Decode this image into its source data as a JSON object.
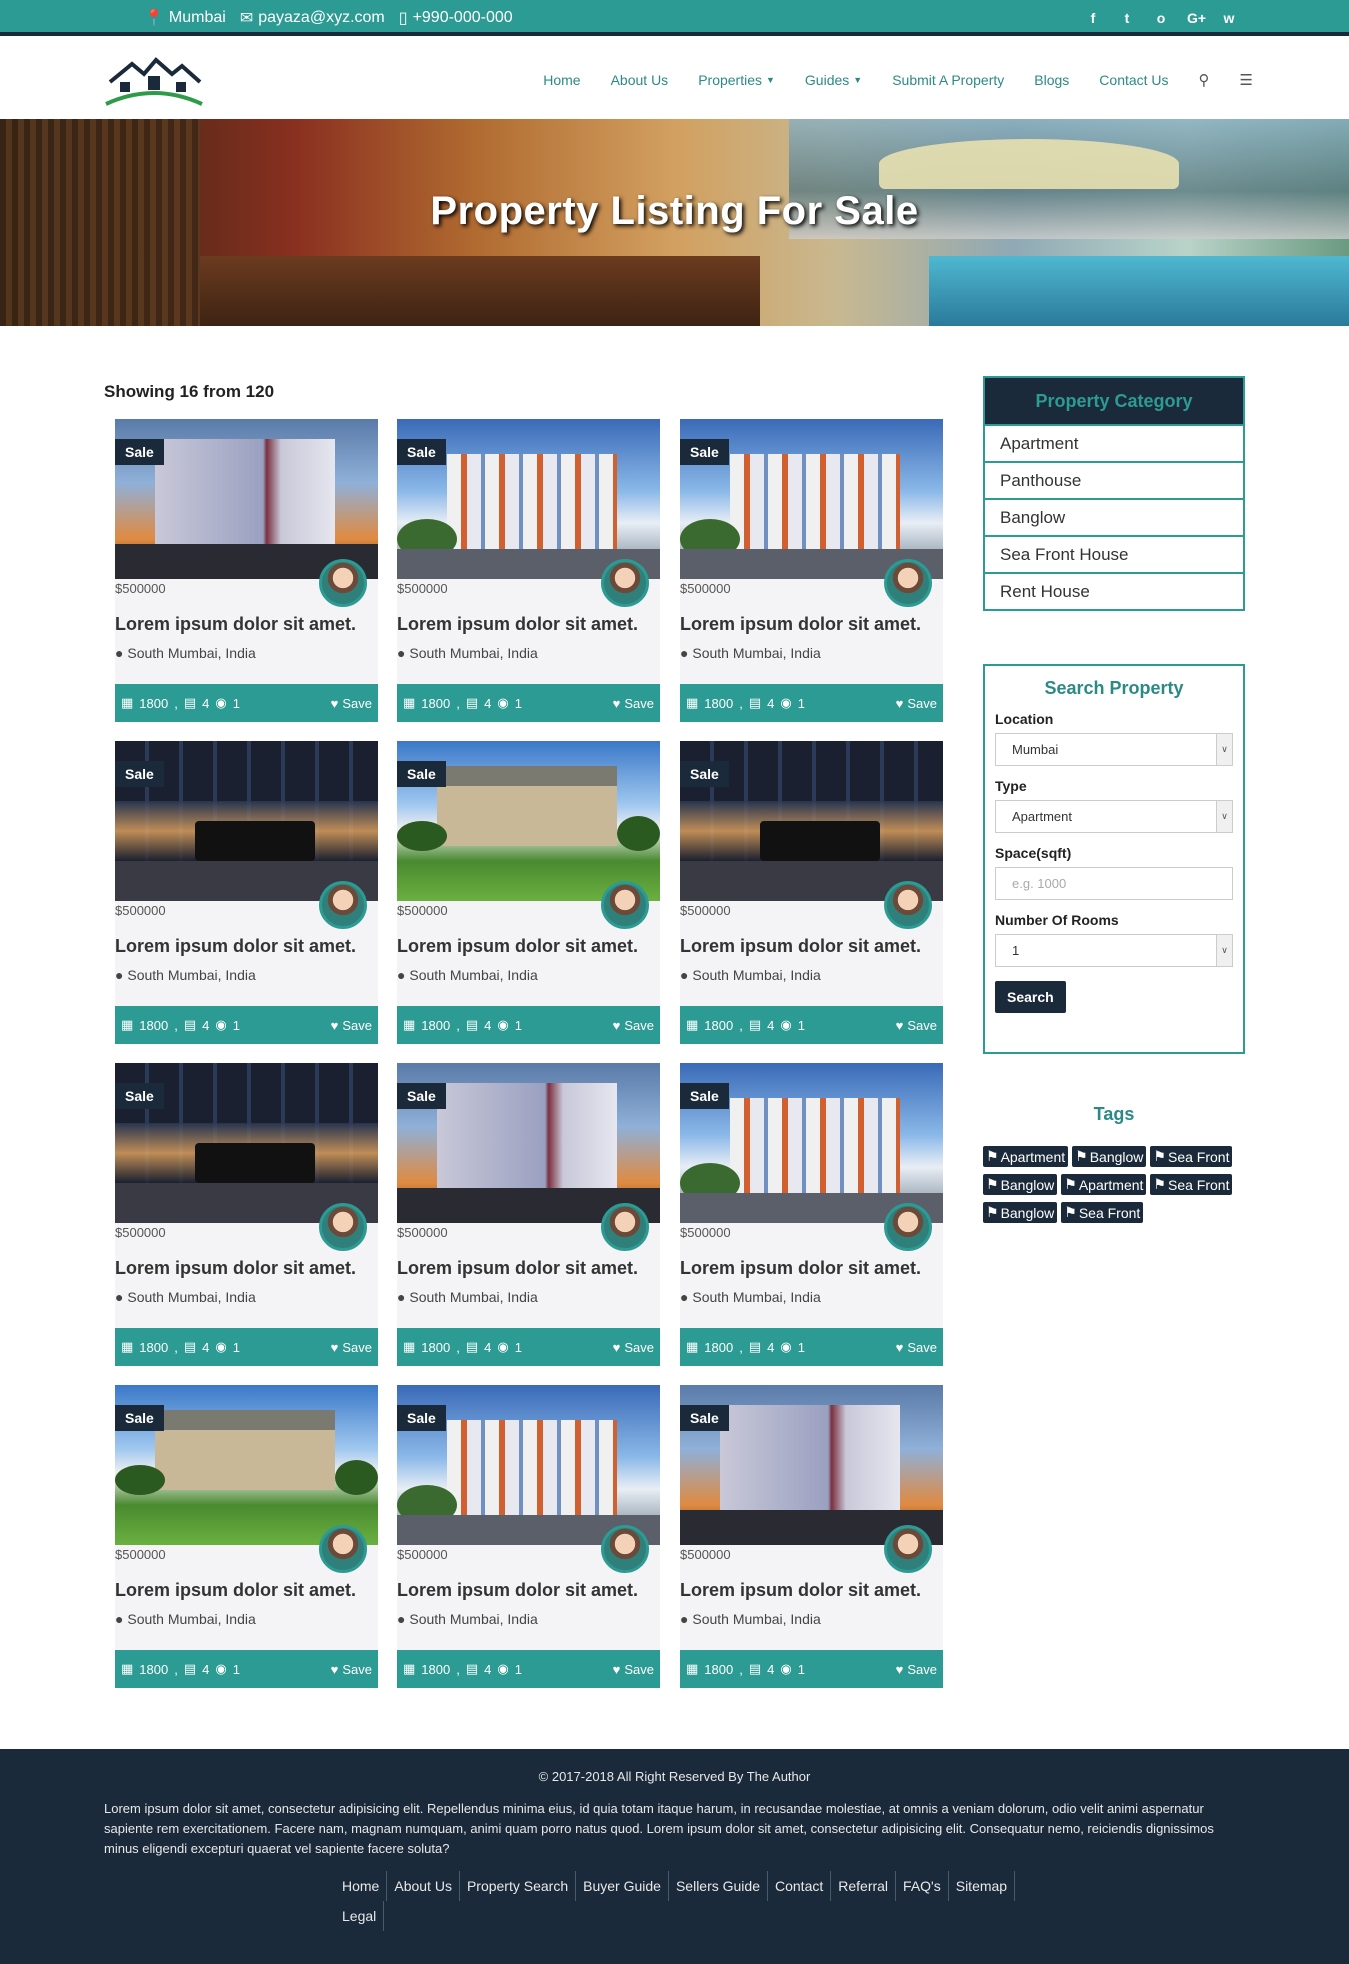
{
  "topbar": {
    "city": "Mumbai",
    "email": "payaza@xyz.com",
    "phone": "+990-000-000",
    "social": [
      "f",
      "t",
      "o",
      "G+",
      "w"
    ]
  },
  "nav": {
    "items": [
      "Home",
      "About Us",
      "Properties",
      "Guides",
      "Submit A Property",
      "Blogs",
      "Contact Us"
    ]
  },
  "hero": {
    "title": "Property Listing For Sale"
  },
  "listing": {
    "showing": "Showing 16 from 120",
    "cards": [
      {
        "badge": "Sale",
        "price": "$500000",
        "title": "Lorem ipsum dolor sit amet.",
        "location": "South Mumbai, India",
        "area": "1800",
        "beds": "4",
        "cars": "1",
        "save": "Save",
        "img": "modern"
      },
      {
        "badge": "Sale",
        "price": "$500000",
        "title": "Lorem ipsum dolor sit amet.",
        "location": "South Mumbai, India",
        "area": "1800",
        "beds": "4",
        "cars": "1",
        "save": "Save",
        "img": "apartment"
      },
      {
        "badge": "Sale",
        "price": "$500000",
        "title": "Lorem ipsum dolor sit amet.",
        "location": "South Mumbai, India",
        "area": "1800",
        "beds": "4",
        "cars": "1",
        "save": "Save",
        "img": "apartment"
      },
      {
        "badge": "Sale",
        "price": "$500000",
        "title": "Lorem ipsum dolor sit amet.",
        "location": "South Mumbai, India",
        "area": "1800",
        "beds": "4",
        "cars": "1",
        "save": "Save",
        "img": "interior"
      },
      {
        "badge": "Sale",
        "price": "$500000",
        "title": "Lorem ipsum dolor sit amet.",
        "location": "South Mumbai, India",
        "area": "1800",
        "beds": "4",
        "cars": "1",
        "save": "Save",
        "img": "house"
      },
      {
        "badge": "Sale",
        "price": "$500000",
        "title": "Lorem ipsum dolor sit amet.",
        "location": "South Mumbai, India",
        "area": "1800",
        "beds": "4",
        "cars": "1",
        "save": "Save",
        "img": "interior"
      },
      {
        "badge": "Sale",
        "price": "$500000",
        "title": "Lorem ipsum dolor sit amet.",
        "location": "South Mumbai, India",
        "area": "1800",
        "beds": "4",
        "cars": "1",
        "save": "Save",
        "img": "interior"
      },
      {
        "badge": "Sale",
        "price": "$500000",
        "title": "Lorem ipsum dolor sit amet.",
        "location": "South Mumbai, India",
        "area": "1800",
        "beds": "4",
        "cars": "1",
        "save": "Save",
        "img": "modern"
      },
      {
        "badge": "Sale",
        "price": "$500000",
        "title": "Lorem ipsum dolor sit amet.",
        "location": "South Mumbai, India",
        "area": "1800",
        "beds": "4",
        "cars": "1",
        "save": "Save",
        "img": "apartment"
      },
      {
        "badge": "Sale",
        "price": "$500000",
        "title": "Lorem ipsum dolor sit amet.",
        "location": "South Mumbai, India",
        "area": "1800",
        "beds": "4",
        "cars": "1",
        "save": "Save",
        "img": "house"
      },
      {
        "badge": "Sale",
        "price": "$500000",
        "title": "Lorem ipsum dolor sit amet.",
        "location": "South Mumbai, India",
        "area": "1800",
        "beds": "4",
        "cars": "1",
        "save": "Save",
        "img": "apartment"
      },
      {
        "badge": "Sale",
        "price": "$500000",
        "title": "Lorem ipsum dolor sit amet.",
        "location": "South Mumbai, India",
        "area": "1800",
        "beds": "4",
        "cars": "1",
        "save": "Save",
        "img": "modern"
      }
    ]
  },
  "sidebar": {
    "category_title": "Property Category",
    "categories": [
      "Apartment",
      "Panthouse",
      "Banglow",
      "Sea Front House",
      "Rent House"
    ],
    "search": {
      "title": "Search Property",
      "location_label": "Location",
      "location_value": "Mumbai",
      "type_label": "Type",
      "type_value": "Apartment",
      "space_label": "Space(sqft)",
      "space_placeholder": "e.g. 1000",
      "rooms_label": "Number Of Rooms",
      "rooms_value": "1",
      "button": "Search"
    },
    "tags_title": "Tags",
    "tags": [
      "Apartment",
      "Banglow",
      "Sea Front",
      "Banglow",
      "Apartment",
      "Sea Front",
      "Banglow",
      "Sea Front"
    ]
  },
  "footer": {
    "copyright": "© 2017-2018 All Right Reserved By The Author",
    "text": "Lorem ipsum dolor sit amet, consectetur adipisicing elit. Repellendus minima eius, id quia totam itaque harum, in recusandae molestiae, at omnis a veniam dolorum, odio velit animi aspernatur sapiente rem exercitationem. Facere nam, magnam numquam, animi quam porro natus quod. Lorem ipsum dolor sit amet, consectetur adipisicing elit. Consequatur nemo, reiciendis dignissimos minus eligendi excepturi quaerat vel sapiente facere soluta?",
    "links": [
      "Home",
      "About Us",
      "Property Search",
      "Buyer Guide",
      "Sellers Guide",
      "Contact",
      "Referral",
      "FAQ's",
      "Sitemap",
      "Legal"
    ]
  },
  "colors": {
    "teal": "#2c9b93",
    "navy": "#1b2a3a"
  }
}
